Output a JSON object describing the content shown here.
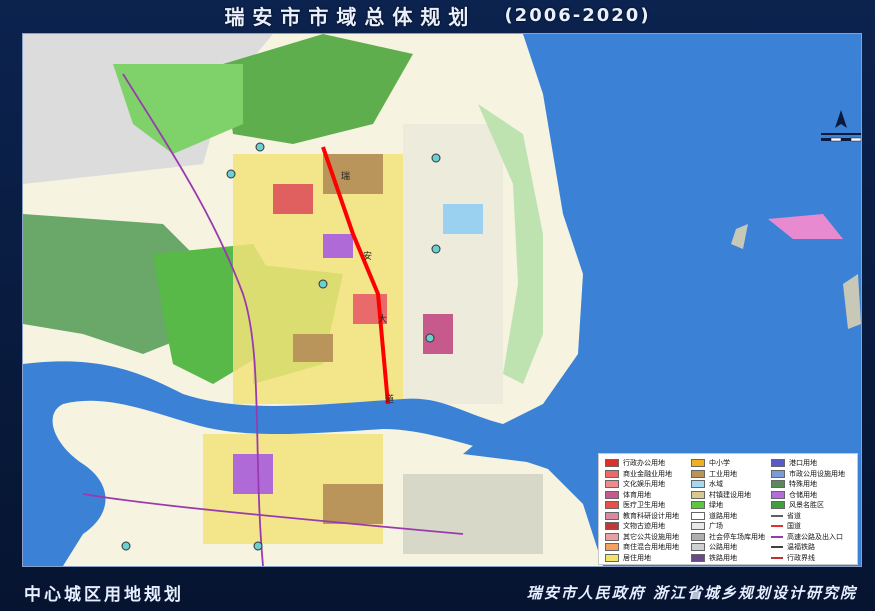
{
  "title": {
    "main": "瑞安市市域总体规划",
    "period": "(2006-2020)"
  },
  "footer": {
    "left": "中心城区用地规划",
    "right": "瑞安市人民政府 浙江省城乡规划设计研究院"
  },
  "map_labels": {
    "vertical_label": [
      "瑞",
      "安",
      "大",
      "道"
    ]
  },
  "legend": {
    "col1": [
      {
        "label": "行政办公用地",
        "color": "#e0302a"
      },
      {
        "label": "商业金融业用地",
        "color": "#e86a6a"
      },
      {
        "label": "文化娱乐用地",
        "color": "#f08a8a"
      },
      {
        "label": "体育用地",
        "color": "#c75a8c"
      },
      {
        "label": "医疗卫生用地",
        "color": "#e8504a"
      },
      {
        "label": "教育科研设计用地",
        "color": "#d98aa0"
      },
      {
        "label": "文物古迹用地",
        "color": "#c03838"
      },
      {
        "label": "其它公共设施用地",
        "color": "#e8a0a0"
      },
      {
        "label": "商住混合用地用地",
        "color": "#f3a060"
      },
      {
        "label": "居住用地",
        "color": "#f2e36b"
      }
    ],
    "col2": [
      {
        "label": "中小学",
        "color": "#f0b020"
      },
      {
        "label": "工业用地",
        "color": "#b9955c"
      },
      {
        "label": "水域",
        "color": "#a8d8f0"
      },
      {
        "label": "村镇建设用地",
        "color": "#d8c890"
      },
      {
        "label": "绿地",
        "color": "#5cc840"
      },
      {
        "label": "道路用地",
        "color": "#ffffff"
      },
      {
        "label": "广场",
        "color": "#e8e8e8"
      },
      {
        "label": "社会停车场库用地",
        "color": "#b0b0b0"
      },
      {
        "label": "公路用地",
        "color": "#d0d0d0"
      },
      {
        "label": "铁路用地",
        "color": "#6a4a8a"
      }
    ],
    "col3": [
      {
        "label": "港口用地",
        "color": "#5a5ac8",
        "kind": "fill"
      },
      {
        "label": "市政公用设施用地",
        "color": "#7a9ad8",
        "kind": "fill"
      },
      {
        "label": "特殊用地",
        "color": "#5a8a5a",
        "kind": "fill"
      },
      {
        "label": "仓储用地",
        "color": "#b070d8",
        "kind": "fill"
      },
      {
        "label": "风景名胜区",
        "color": "#40a040",
        "kind": "fill"
      },
      {
        "label": "省道",
        "color": "#606060",
        "kind": "line"
      },
      {
        "label": "国道",
        "color": "#e03030",
        "kind": "line"
      },
      {
        "label": "高速公路及出入口",
        "color": "#9a3ab0",
        "kind": "line"
      },
      {
        "label": "温福铁路",
        "color": "#404040",
        "kind": "line"
      },
      {
        "label": "行政界线",
        "color": "#c03030",
        "kind": "line"
      }
    ]
  }
}
